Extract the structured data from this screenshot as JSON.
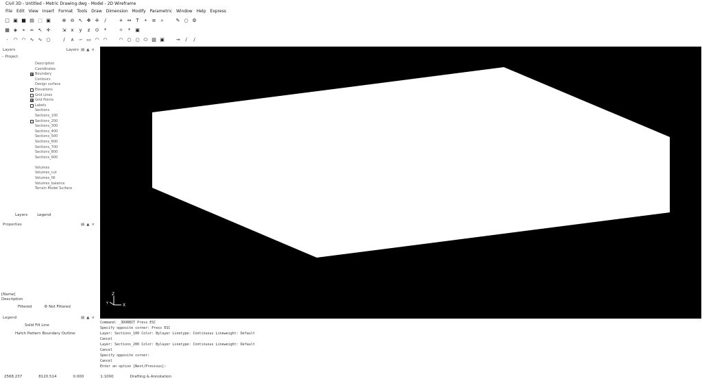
{
  "window": {
    "title": "Civil 3D - Untitled - Metric Drawing.dwg - Model - 2D Wireframe"
  },
  "menu": [
    "File",
    "Edit",
    "View",
    "Insert",
    "Format",
    "Tools",
    "Draw",
    "Dimension",
    "Modify",
    "Parametric",
    "Window",
    "Help",
    "Express"
  ],
  "toolbar_rows": [
    {
      "name": "standard",
      "buttons": [
        "new-icon",
        "open-icon",
        "save-icon",
        "print-icon",
        "zoom-window-icon",
        "zoom-extents-icon",
        "zoom-in-icon",
        "zoom-out-icon",
        "select-icon",
        "pan-icon",
        "move-icon",
        "line-icon",
        "plus-icon",
        "measure-icon",
        "text-icon",
        "dots-icon",
        "layer-icon",
        "search-icon",
        "pencil-icon",
        "bulb-icon",
        "settings-icon"
      ]
    },
    {
      "name": "layers",
      "buttons": [
        "grid-icon",
        "layers-icon",
        "snap-icon",
        "chain-icon",
        "cursor-icon",
        "move-icon",
        "scale-icon",
        "x-icon",
        "y-icon",
        "z-icon",
        "origin-icon",
        "star-icon",
        "wand-icon",
        "star-icon",
        "view-icon"
      ]
    },
    {
      "name": "draw",
      "buttons": [
        "point-icon",
        "arc-icon",
        "arc-icon",
        "curve-icon",
        "curve-icon",
        "circle-icon",
        "line-icon",
        "polyline-icon",
        "spline-icon",
        "rectangle-icon",
        "arc-icon",
        "arc-icon",
        "arc-icon",
        "circle-icon",
        "circle-icon",
        "ellipse-icon",
        "hatch-icon",
        "block-icon",
        "arrow-icon",
        "line-icon",
        "line-icon"
      ]
    }
  ],
  "layers_panel": {
    "title": "Layers",
    "tab_label": "Layers",
    "root": "Project",
    "items": [
      {
        "label": "Description",
        "check": "none"
      },
      {
        "label": "Coordinates",
        "check": "none"
      },
      {
        "label": "Boundary",
        "check": "checked"
      },
      {
        "label": "Contours",
        "check": "none"
      },
      {
        "label": "Design surface",
        "check": "none"
      },
      {
        "label": "Elevations",
        "check": "box"
      },
      {
        "label": "Grid Lines",
        "check": "box"
      },
      {
        "label": "Grid Points",
        "check": "checked"
      },
      {
        "label": "Labels",
        "check": "box"
      },
      {
        "label": "Sections",
        "check": "none"
      },
      {
        "label": "Sections_100",
        "check": "none"
      },
      {
        "label": "Sections_200",
        "check": "expand"
      },
      {
        "label": "Sections_300",
        "check": "none"
      },
      {
        "label": "Sections_400",
        "check": "none"
      },
      {
        "label": "Sections_500",
        "check": "none"
      },
      {
        "label": "Sections_600",
        "check": "none"
      },
      {
        "label": "Sections_700",
        "check": "none"
      },
      {
        "label": "Sections_800",
        "check": "none"
      },
      {
        "label": "Sections_900",
        "check": "none"
      },
      {
        "label": "",
        "check": "gap"
      },
      {
        "label": "Volumes",
        "check": "none"
      },
      {
        "label": "Volumes_cut",
        "check": "none"
      },
      {
        "label": "Volumes_fill",
        "check": "none"
      },
      {
        "label": "Volumes_balance",
        "check": "none"
      },
      {
        "label": "Terrain Model Surface",
        "check": "none"
      }
    ],
    "bottom_tabs": [
      "Layers",
      "Legend"
    ]
  },
  "properties_panel": {
    "title": "Properties",
    "tags": [
      "[Name]",
      "Description"
    ],
    "filter_buttons": [
      "Filtered",
      "Not Filtered"
    ]
  },
  "legend_panel": {
    "title": "Legend",
    "row1": "Solid Fill  Line",
    "row2": "Hatch Pattern Boundary  Outline"
  },
  "viewport": {
    "background": "#000000",
    "shape_fill": "#ffffff",
    "axis_z": "Z",
    "axis_x": "X",
    "axis_y": "Y"
  },
  "command_lines": [
    "Command: _3DORBIT Press ESC",
    "Specify opposite corner: Press ESC",
    "Layer: Sections_100 Color: Bylayer Linetype: Continuous Lineweight: Default",
    "Cancel",
    "Layer: Sections_200 Color: Bylayer Linetype: Continuous Lineweight: Default",
    "Cancel",
    "Specify opposite corner:",
    "Cancel",
    "Enter an option [Next/Previous]:"
  ],
  "status_bar": {
    "coords": "2568.237",
    "y": "8120.514",
    "z": "0.000",
    "scale": "1:1000",
    "workspace": "Drafting & Annotation"
  }
}
